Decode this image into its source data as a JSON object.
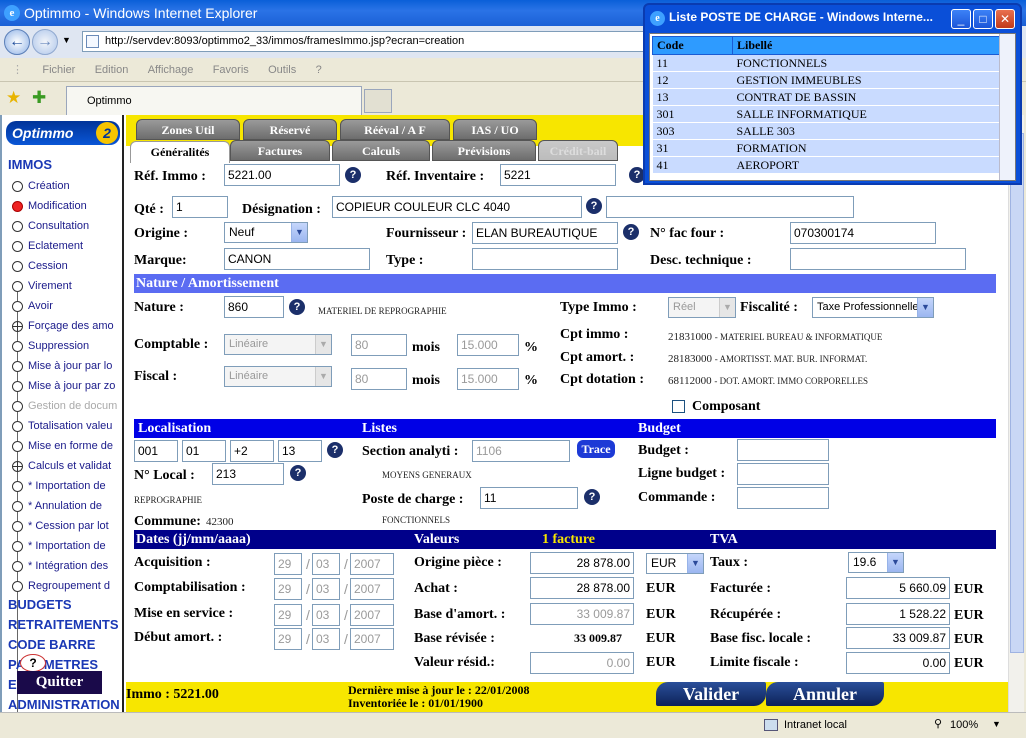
{
  "browser": {
    "window_title": "Optimmo - Windows Internet Explorer",
    "url": "http://servdev:8093/optimmo2_33/immos/framesImmo.jsp?ecran=creation",
    "menu": [
      "Fichier",
      "Edition",
      "Affichage",
      "Favoris",
      "Outils",
      "?"
    ],
    "tab_title": "Optimmo",
    "status_zone": "Intranet local",
    "zoom": "100%"
  },
  "popup": {
    "title": "Liste POSTE DE CHARGE - Windows Interne...",
    "headers": [
      "Code",
      "Libellé"
    ],
    "rows": [
      {
        "code": "11",
        "label": "FONCTIONNELS"
      },
      {
        "code": "12",
        "label": "GESTION IMMEUBLES"
      },
      {
        "code": "13",
        "label": "CONTRAT DE BASSIN"
      },
      {
        "code": "301",
        "label": "SALLE INFORMATIQUE"
      },
      {
        "code": "303",
        "label": "SALLE 303"
      },
      {
        "code": "31",
        "label": "FORMATION"
      },
      {
        "code": "41",
        "label": "AEROPORT"
      }
    ]
  },
  "nav": {
    "logo": "Optimmo",
    "logo_num": "2",
    "section_immos": "IMMOS",
    "items": [
      {
        "label": "Création",
        "state": "normal"
      },
      {
        "label": "Modification",
        "state": "active"
      },
      {
        "label": "Consultation",
        "state": "normal"
      },
      {
        "label": "Eclatement",
        "state": "normal"
      },
      {
        "label": "Cession",
        "state": "normal"
      },
      {
        "label": "Virement",
        "state": "normal"
      },
      {
        "label": "Avoir",
        "state": "normal"
      },
      {
        "label": "Forçage des amo",
        "state": "plus"
      },
      {
        "label": "Suppression",
        "state": "normal"
      },
      {
        "label": "Mise à jour par lo",
        "state": "normal"
      },
      {
        "label": "Mise à jour par zo",
        "state": "normal"
      },
      {
        "label": "Gestion de docum",
        "state": "gray"
      },
      {
        "label": "Totalisation valeu",
        "state": "normal"
      },
      {
        "label": "Mise en forme de",
        "state": "normal"
      },
      {
        "label": "Calculs et validat",
        "state": "plus"
      },
      {
        "label": "* Importation de",
        "state": "normal"
      },
      {
        "label": "* Annulation de",
        "state": "normal"
      },
      {
        "label": "* Cession par lot",
        "state": "normal"
      },
      {
        "label": "* Importation de",
        "state": "normal"
      },
      {
        "label": "* Intégration des",
        "state": "normal"
      },
      {
        "label": "Regroupement d",
        "state": "normal"
      }
    ],
    "sections": [
      "BUDGETS",
      "RETRAITEMENTS",
      "CODE BARRE",
      "PARAMETRES",
      "E",
      "ADMINISTRATION"
    ],
    "help": "?",
    "quit": "Quitter"
  },
  "tabs": {
    "row1": [
      "Zones Util",
      "Réservé",
      "Rééval / A F",
      "IAS / UO"
    ],
    "row2": [
      "Généralités",
      "Factures",
      "Calculs",
      "Prévisions",
      "Crédit-bail"
    ]
  },
  "form": {
    "ref_immo_label": "Réf. Immo :",
    "ref_immo": "5221.00",
    "ref_inv_label": "Réf. Inventaire :",
    "ref_inv": "5221",
    "qte_label": "Qté :",
    "qte": "1",
    "designation_label": "Désignation :",
    "designation": "COPIEUR COULEUR CLC 4040",
    "designation2": "",
    "origine_label": "Origine :",
    "origine": "Neuf",
    "fournisseur_label": "Fournisseur :",
    "fournisseur": "ELAN BUREAUTIQUE",
    "nfac_label": "N° fac four :",
    "nfac": "070300174",
    "marque_label": "Marque:",
    "marque": "CANON",
    "type_label": "Type :",
    "type": "",
    "desc_label": "Desc. technique :",
    "desc": ""
  },
  "nature": {
    "band": "Nature / Amortissement",
    "nature_label": "Nature :",
    "nature": "860",
    "nature_desc": "MATERIEL DE REPROGRAPHIE",
    "type_immo_label": "Type Immo :",
    "type_immo": "Réel",
    "fiscalite_label": "Fiscalité :",
    "fiscalite": "Taxe Professionnelle",
    "comptable_label": "Comptable :",
    "comptable_mode": "Linéaire",
    "comptable_mois": "80",
    "comptable_pct": "15.000",
    "fiscal_label": "Fiscal :",
    "fiscal_mode": "Linéaire",
    "fiscal_mois": "80",
    "fiscal_pct": "15.000",
    "mois": "mois",
    "pct": "%",
    "cpt_immo_label": "Cpt immo :",
    "cpt_immo": "21831000",
    "cpt_immo_desc": "- MATERIEL BUREAU & INFORMATIQUE",
    "cpt_amort_label": "Cpt amort. :",
    "cpt_amort": "28183000",
    "cpt_amort_desc": "- AMORTISST. MAT. BUR. INFORMAT.",
    "cpt_dot_label": "Cpt dotation :",
    "cpt_dot": "68112000",
    "cpt_dot_desc": "- DOT. AMORT. IMMO CORPORELLES",
    "composant": "Composant"
  },
  "localisation": {
    "band_loc": "Localisation",
    "band_listes": "Listes",
    "band_budget": "Budget",
    "codes": [
      "001",
      "01",
      "+2",
      "13"
    ],
    "nlocal_label": "N° Local :",
    "nlocal": "213",
    "nlocal_desc": "REPROGRAPHIE",
    "commune_label": "Commune:",
    "commune": "42300",
    "section_label": "Section analyti :",
    "section": "1106",
    "section_desc": "MOYENS GENERAUX",
    "trace": "Trace",
    "poste_label": "Poste de charge :",
    "poste": "11",
    "poste_desc": "FONCTIONNELS",
    "budget_label": "Budget :",
    "ligne_label": "Ligne budget :",
    "commande_label": "Commande :"
  },
  "dates": {
    "band_dates": "Dates (jj/mm/aaaa)",
    "band_valeurs": "Valeurs",
    "band_facture": "1 facture",
    "band_tva": "TVA",
    "rows": [
      {
        "label": "Acquisition :",
        "d": "29",
        "m": "03",
        "y": "2007"
      },
      {
        "label": "Comptabilisation :",
        "d": "29",
        "m": "03",
        "y": "2007"
      },
      {
        "label": "Mise en service :",
        "d": "29",
        "m": "03",
        "y": "2007"
      },
      {
        "label": "Début amort. :",
        "d": "29",
        "m": "03",
        "y": "2007"
      }
    ],
    "origine_label": "Origine pièce :",
    "origine": "28 878.00",
    "currency_sel": "EUR",
    "achat_label": "Achat :",
    "achat": "28 878.00",
    "base_label": "Base d'amort. :",
    "base": "33 009.87",
    "base_rev_label": "Base révisée :",
    "base_rev": "33 009.87",
    "valeur_label": "Valeur résid.:",
    "valeur": "0.00",
    "eur": "EUR",
    "taux_label": "Taux :",
    "taux": "19.6",
    "facturee_label": "Facturée :",
    "facturee": "5 660.09",
    "recup_label": "Récupérée :",
    "recup": "1 528.22",
    "basefisc_label": "Base fisc. locale :",
    "basefisc": "33 009.87",
    "limite_label": "Limite fiscale :",
    "limite": "0.00"
  },
  "bottom": {
    "immo": "Immo : 5221.00",
    "maj": "Dernière mise à jour le : 22/01/2008",
    "inv": "Inventoriée le : 01/01/1900",
    "valider": "Valider",
    "annuler": "Annuler"
  }
}
